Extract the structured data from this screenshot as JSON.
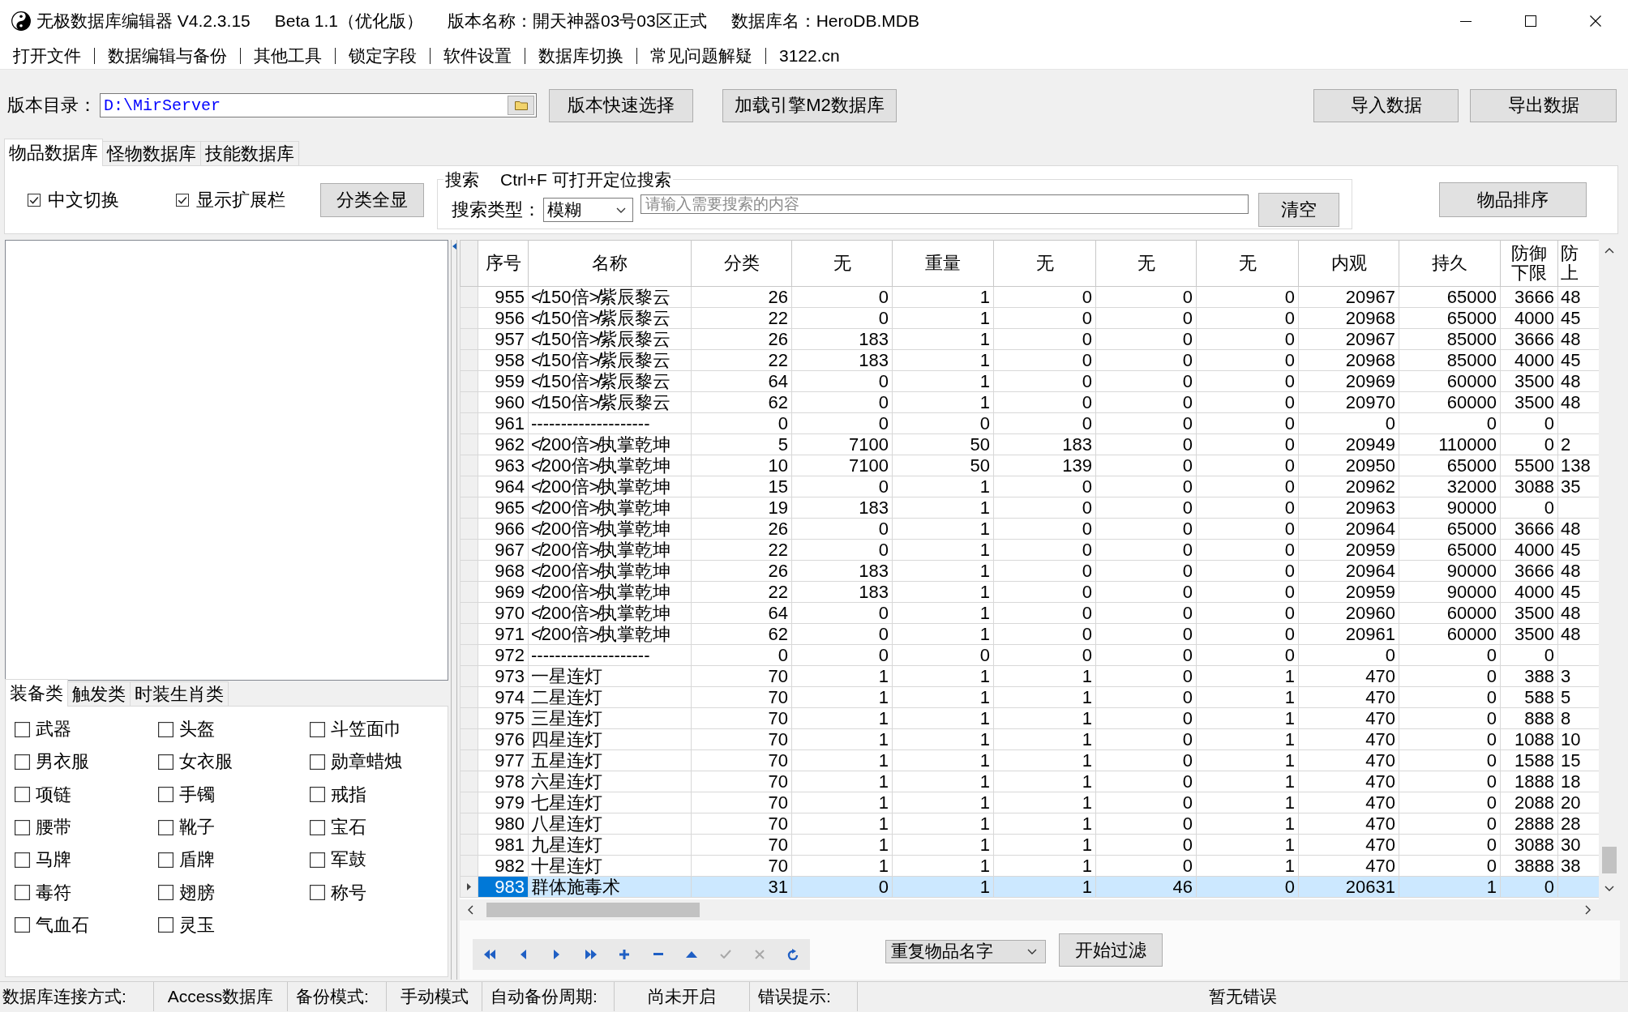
{
  "window": {
    "title": "无极数据库编辑器 V4.2.3.15",
    "edition": "Beta 1.1（优化版）",
    "version_name": "版本名称：開天神器03号03区正式",
    "database_name": "数据库名：HeroDB.MDB"
  },
  "menu": [
    "打开文件",
    "数据编辑与备份",
    "其他工具",
    "锁定字段",
    "软件设置",
    "数据库切换",
    "常见问题解疑",
    "3122.cn"
  ],
  "path_bar": {
    "label": "版本目录：",
    "value": "D:\\MirServer",
    "buttons": [
      "版本快速选择",
      "加载引擎M2数据库"
    ]
  },
  "data_buttons": [
    "导入数据",
    "导出数据"
  ],
  "tabs": [
    {
      "label": "物品数据库",
      "selected": true
    },
    {
      "label": "怪物数据库",
      "selected": false
    },
    {
      "label": "技能数据库",
      "selected": false
    }
  ],
  "options": {
    "toggles": [
      {
        "label": "中文切换",
        "checked": true
      },
      {
        "label": "显示扩展栏",
        "checked": true
      }
    ],
    "show_all_button": "分类全显",
    "sort_button": "物品排序"
  },
  "search": {
    "title": "搜索",
    "hint": "Ctrl+F 可打开定位搜索",
    "type_label": "搜索类型：",
    "type_value": "模糊",
    "placeholder": "请输入需要搜索的内容",
    "clear_button": "清空"
  },
  "category_tabs": [
    {
      "label": "装备类",
      "selected": true
    },
    {
      "label": "触发类",
      "selected": false
    },
    {
      "label": "时装生肖类",
      "selected": false
    }
  ],
  "categories": [
    {
      "label": "武器",
      "checked": false
    },
    {
      "label": "头盔",
      "checked": false
    },
    {
      "label": "斗笠面巾",
      "checked": false
    },
    {
      "label": "男衣服",
      "checked": false
    },
    {
      "label": "女衣服",
      "checked": false
    },
    {
      "label": "勋章蜡烛",
      "checked": false
    },
    {
      "label": "项链",
      "checked": false
    },
    {
      "label": "手镯",
      "checked": false
    },
    {
      "label": "戒指",
      "checked": false
    },
    {
      "label": "腰带",
      "checked": false
    },
    {
      "label": "靴子",
      "checked": false
    },
    {
      "label": "宝石",
      "checked": false
    },
    {
      "label": "马牌",
      "checked": false
    },
    {
      "label": "盾牌",
      "checked": false
    },
    {
      "label": "军鼓",
      "checked": false
    },
    {
      "label": "毒符",
      "checked": false
    },
    {
      "label": "翅膀",
      "checked": false
    },
    {
      "label": "称号",
      "checked": false
    },
    {
      "label": "气血石",
      "checked": false
    },
    {
      "label": "灵玉",
      "checked": false
    }
  ],
  "table": {
    "columns": [
      "序号",
      "名称",
      "分类",
      "无",
      "重量",
      "无",
      "无",
      "无",
      "内观",
      "持久",
      "防御下限",
      "防上"
    ],
    "rows": [
      {
        "cells": [
          "955",
          "≮150倍≯紫辰黎云",
          "26",
          "0",
          "1",
          "0",
          "0",
          "0",
          "20967",
          "65000",
          "3666",
          "48"
        ],
        "selected": false
      },
      {
        "cells": [
          "956",
          "≮150倍≯紫辰黎云",
          "22",
          "0",
          "1",
          "0",
          "0",
          "0",
          "20968",
          "65000",
          "4000",
          "45"
        ],
        "selected": false
      },
      {
        "cells": [
          "957",
          "≮150倍≯紫辰黎云",
          "26",
          "183",
          "1",
          "0",
          "0",
          "0",
          "20967",
          "85000",
          "3666",
          "48"
        ],
        "selected": false
      },
      {
        "cells": [
          "958",
          "≮150倍≯紫辰黎云",
          "22",
          "183",
          "1",
          "0",
          "0",
          "0",
          "20968",
          "85000",
          "4000",
          "45"
        ],
        "selected": false
      },
      {
        "cells": [
          "959",
          "≮150倍≯紫辰黎云",
          "64",
          "0",
          "1",
          "0",
          "0",
          "0",
          "20969",
          "60000",
          "3500",
          "48"
        ],
        "selected": false
      },
      {
        "cells": [
          "960",
          "≮150倍≯紫辰黎云",
          "62",
          "0",
          "1",
          "0",
          "0",
          "0",
          "20970",
          "60000",
          "3500",
          "48"
        ],
        "selected": false
      },
      {
        "cells": [
          "961",
          "--------------------",
          "0",
          "0",
          "0",
          "0",
          "0",
          "0",
          "0",
          "0",
          "0"
        ],
        "selected": false
      },
      {
        "cells": [
          "962",
          "≮200倍≯执掌乾坤",
          "5",
          "7100",
          "50",
          "183",
          "0",
          "0",
          "20949",
          "110000",
          "0",
          "2"
        ],
        "selected": false
      },
      {
        "cells": [
          "963",
          "≮200倍≯执掌乾坤",
          "10",
          "7100",
          "50",
          "139",
          "0",
          "0",
          "20950",
          "65000",
          "5500",
          "138"
        ],
        "selected": false
      },
      {
        "cells": [
          "964",
          "≮200倍≯执掌乾坤",
          "15",
          "0",
          "1",
          "0",
          "0",
          "0",
          "20962",
          "32000",
          "3088",
          "35"
        ],
        "selected": false
      },
      {
        "cells": [
          "965",
          "≮200倍≯执掌乾坤",
          "19",
          "183",
          "1",
          "0",
          "0",
          "0",
          "20963",
          "90000",
          "0"
        ],
        "selected": false
      },
      {
        "cells": [
          "966",
          "≮200倍≯执掌乾坤",
          "26",
          "0",
          "1",
          "0",
          "0",
          "0",
          "20964",
          "65000",
          "3666",
          "48"
        ],
        "selected": false
      },
      {
        "cells": [
          "967",
          "≮200倍≯执掌乾坤",
          "22",
          "0",
          "1",
          "0",
          "0",
          "0",
          "20959",
          "65000",
          "4000",
          "45"
        ],
        "selected": false
      },
      {
        "cells": [
          "968",
          "≮200倍≯执掌乾坤",
          "26",
          "183",
          "1",
          "0",
          "0",
          "0",
          "20964",
          "90000",
          "3666",
          "48"
        ],
        "selected": false
      },
      {
        "cells": [
          "969",
          "≮200倍≯执掌乾坤",
          "22",
          "183",
          "1",
          "0",
          "0",
          "0",
          "20959",
          "90000",
          "4000",
          "45"
        ],
        "selected": false
      },
      {
        "cells": [
          "970",
          "≮200倍≯执掌乾坤",
          "64",
          "0",
          "1",
          "0",
          "0",
          "0",
          "20960",
          "60000",
          "3500",
          "48"
        ],
        "selected": false
      },
      {
        "cells": [
          "971",
          "≮200倍≯执掌乾坤",
          "62",
          "0",
          "1",
          "0",
          "0",
          "0",
          "20961",
          "60000",
          "3500",
          "48"
        ],
        "selected": false
      },
      {
        "cells": [
          "972",
          "--------------------",
          "0",
          "0",
          "0",
          "0",
          "0",
          "0",
          "0",
          "0",
          "0"
        ],
        "selected": false
      },
      {
        "cells": [
          "973",
          "一星连灯",
          "70",
          "1",
          "1",
          "1",
          "0",
          "1",
          "470",
          "0",
          "388",
          "3"
        ],
        "selected": false
      },
      {
        "cells": [
          "974",
          "二星连灯",
          "70",
          "1",
          "1",
          "1",
          "0",
          "1",
          "470",
          "0",
          "588",
          "5"
        ],
        "selected": false
      },
      {
        "cells": [
          "975",
          "三星连灯",
          "70",
          "1",
          "1",
          "1",
          "0",
          "1",
          "470",
          "0",
          "888",
          "8"
        ],
        "selected": false
      },
      {
        "cells": [
          "976",
          "四星连灯",
          "70",
          "1",
          "1",
          "1",
          "0",
          "1",
          "470",
          "0",
          "1088",
          "10"
        ],
        "selected": false
      },
      {
        "cells": [
          "977",
          "五星连灯",
          "70",
          "1",
          "1",
          "1",
          "0",
          "1",
          "470",
          "0",
          "1588",
          "15"
        ],
        "selected": false
      },
      {
        "cells": [
          "978",
          "六星连灯",
          "70",
          "1",
          "1",
          "1",
          "0",
          "1",
          "470",
          "0",
          "1888",
          "18"
        ],
        "selected": false
      },
      {
        "cells": [
          "979",
          "七星连灯",
          "70",
          "1",
          "1",
          "1",
          "0",
          "1",
          "470",
          "0",
          "2088",
          "20"
        ],
        "selected": false
      },
      {
        "cells": [
          "980",
          "八星连灯",
          "70",
          "1",
          "1",
          "1",
          "0",
          "1",
          "470",
          "0",
          "2888",
          "28"
        ],
        "selected": false
      },
      {
        "cells": [
          "981",
          "九星连灯",
          "70",
          "1",
          "1",
          "1",
          "0",
          "1",
          "470",
          "0",
          "3088",
          "30"
        ],
        "selected": false
      },
      {
        "cells": [
          "982",
          "十星连灯",
          "70",
          "1",
          "1",
          "1",
          "0",
          "1",
          "470",
          "0",
          "3888",
          "38"
        ],
        "selected": false
      },
      {
        "cells": [
          "983",
          "群体施毒术",
          "31",
          "0",
          "1",
          "1",
          "46",
          "0",
          "20631",
          "1",
          "0"
        ],
        "selected": true
      }
    ]
  },
  "navigator": [
    {
      "kind": "first",
      "disabled": false
    },
    {
      "kind": "prior",
      "disabled": false
    },
    {
      "kind": "next",
      "disabled": false
    },
    {
      "kind": "last",
      "disabled": false
    },
    {
      "kind": "insert",
      "disabled": false
    },
    {
      "kind": "delete",
      "disabled": false
    },
    {
      "kind": "edit",
      "disabled": false
    },
    {
      "kind": "post",
      "disabled": true
    },
    {
      "kind": "cancel",
      "disabled": true
    },
    {
      "kind": "refresh",
      "disabled": false
    }
  ],
  "filter": {
    "value": "重复物品名字",
    "button": "开始过滤"
  },
  "status_bar": [
    {
      "label": "数据库连接方式:",
      "value": "Access数据库"
    },
    {
      "label": "备份模式:",
      "value": "手动模式"
    },
    {
      "label": "自动备份周期:",
      "value": "尚未开启"
    },
    {
      "label": "错误提示:",
      "value": "暂无错误"
    }
  ]
}
